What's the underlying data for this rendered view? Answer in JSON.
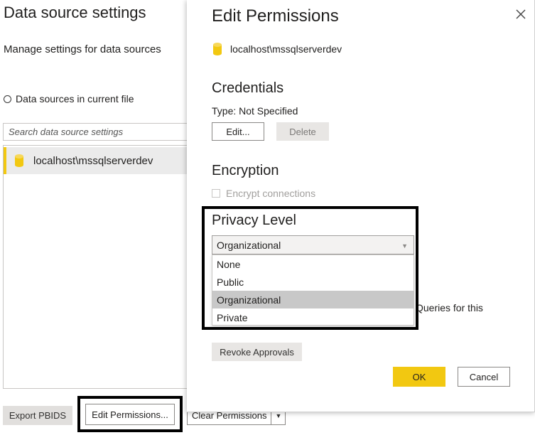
{
  "left_window": {
    "title": "Data source settings",
    "subtitle": "Manage settings for data sources",
    "scope_radio_label": "Data sources in current file",
    "search_placeholder": "Search data source settings",
    "data_sources": [
      {
        "name": "localhost\\mssqlserverdev",
        "icon": "database-icon"
      }
    ],
    "footer": {
      "export_label": "Export PBIDS",
      "edit_permissions_label": "Edit Permissions...",
      "clear_permissions_label": "Clear Permissions"
    }
  },
  "dialog": {
    "title": "Edit Permissions",
    "source_name": "localhost\\mssqlserverdev",
    "credentials": {
      "heading": "Credentials",
      "type_text": "Type: Not Specified",
      "edit_label": "Edit...",
      "delete_label": "Delete"
    },
    "encryption": {
      "heading": "Encryption",
      "checkbox_label": "Encrypt connections",
      "checked": false,
      "enabled": false
    },
    "privacy": {
      "heading": "Privacy Level",
      "selected": "Organizational",
      "options": [
        "None",
        "Public",
        "Organizational",
        "Private"
      ]
    },
    "partial_text": "Queries for this",
    "revoke_label": "Revoke Approvals",
    "ok_label": "OK",
    "cancel_label": "Cancel"
  },
  "colors": {
    "accent_yellow": "#F2C811",
    "selection_gray": "#C8C8C8",
    "highlight_border": "#000000"
  }
}
